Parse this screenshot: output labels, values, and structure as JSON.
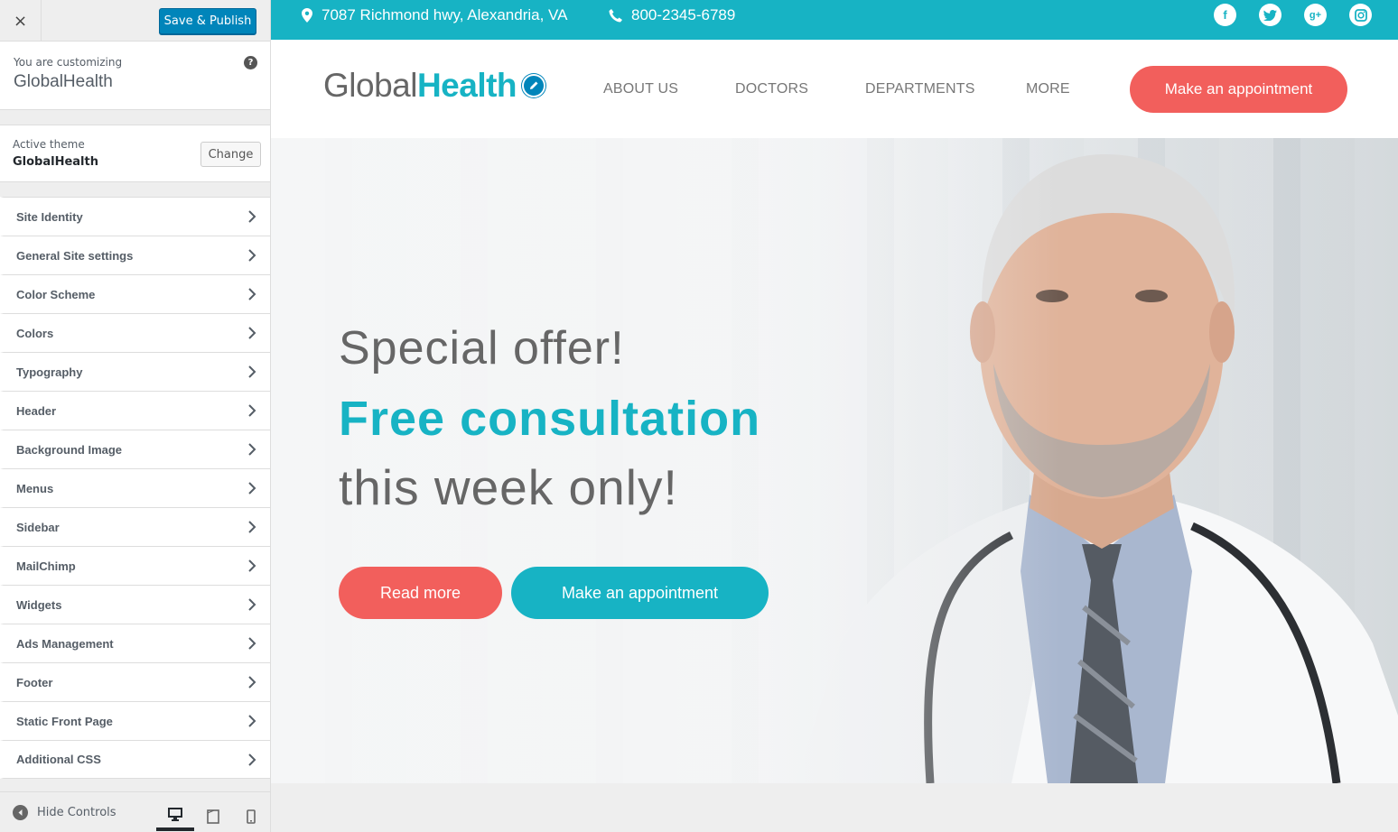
{
  "customizer": {
    "close_label": "×",
    "save_label": "Save & Publish",
    "customizing_label": "You are customizing",
    "site_name": "GlobalHealth",
    "help_label": "?",
    "active_theme_label": "Active theme",
    "active_theme_name": "GlobalHealth",
    "change_label": "Change",
    "sections": [
      {
        "label": "Site Identity"
      },
      {
        "label": "General Site settings"
      },
      {
        "label": "Color Scheme"
      },
      {
        "label": "Colors"
      },
      {
        "label": "Typography"
      },
      {
        "label": "Header"
      },
      {
        "label": "Background Image"
      },
      {
        "label": "Menus"
      },
      {
        "label": "Sidebar"
      },
      {
        "label": "MailChimp"
      },
      {
        "label": "Widgets"
      },
      {
        "label": "Ads Management"
      },
      {
        "label": "Footer"
      },
      {
        "label": "Static Front Page"
      },
      {
        "label": "Additional CSS"
      }
    ],
    "hide_controls_label": "Hide Controls",
    "devices": [
      "desktop",
      "tablet",
      "mobile"
    ],
    "active_device": "desktop"
  },
  "site": {
    "address": "7087 Richmond hwy, Alexandria, VA",
    "phone": "800-2345-6789",
    "social": [
      "facebook-icon",
      "twitter-icon",
      "google-plus-icon",
      "instagram-icon"
    ],
    "logo_light": "Global",
    "logo_bold": "Health",
    "nav": [
      "ABOUT US",
      "DOCTORS",
      "DEPARTMENTS",
      "MORE"
    ],
    "nav_cta": "Make an appointment",
    "hero": {
      "line1": "Special offer!",
      "line2": "Free consultation",
      "line3": "this week only!",
      "read_more": "Read more",
      "appointment": "Make an appointment"
    }
  },
  "colors": {
    "accent": "#17b3c4",
    "coral": "#f25f5c",
    "wp_blue": "#0085ba"
  }
}
